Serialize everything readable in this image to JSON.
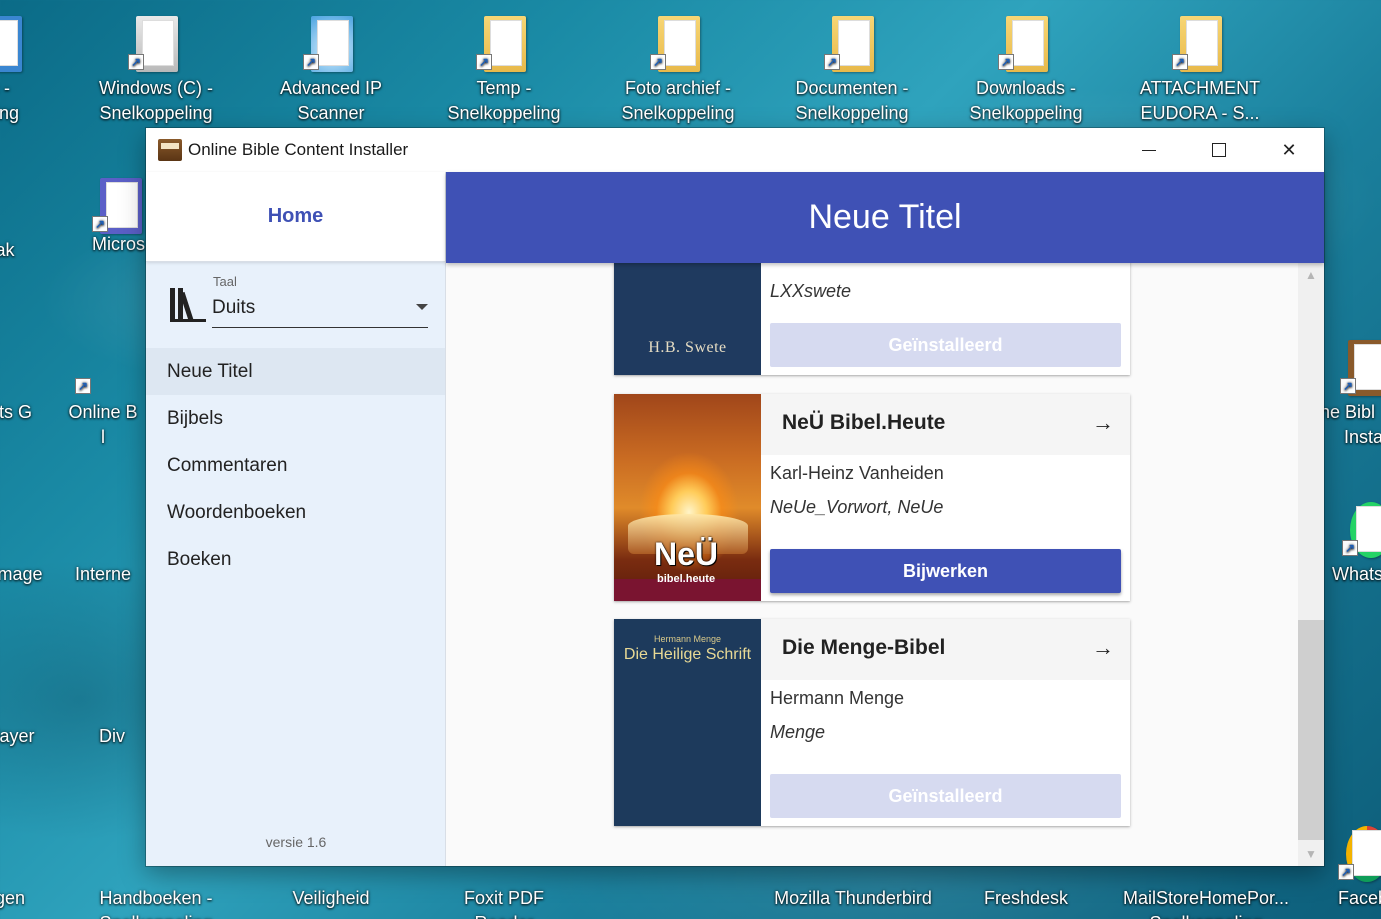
{
  "desktop": {
    "icons": [
      {
        "line1": "c -",
        "line2": "eling"
      },
      {
        "line1": "Windows (C) -",
        "line2": "Snelkoppeling"
      },
      {
        "line1": "Advanced IP Scanner",
        "line2": ""
      },
      {
        "line1": "Temp -",
        "line2": "Snelkoppeling"
      },
      {
        "line1": "Foto archief -",
        "line2": "Snelkoppeling"
      },
      {
        "line1": "Documenten -",
        "line2": "Snelkoppeling"
      },
      {
        "line1": "Downloads -",
        "line2": "Snelkoppeling"
      },
      {
        "line1": "ATTACHMENT",
        "line2": "EUDORA - S..."
      },
      {
        "line1": "oak",
        "line2": ""
      },
      {
        "line1": "Micros",
        "line2": ""
      },
      {
        "line1": "Duits G",
        "line2": ""
      },
      {
        "line1": "Online B",
        "line2": "l"
      },
      {
        "line1": "ne Bibl",
        "line2": "Insta"
      },
      {
        "line1": "e Image",
        "line2": ""
      },
      {
        "line1": "Interne",
        "line2": ""
      },
      {
        "line1": "Whats",
        "line2": ""
      },
      {
        "line1": "player",
        "line2": ""
      },
      {
        "line1": "Div",
        "line2": ""
      },
      {
        "line1": "gen",
        "line2": ""
      },
      {
        "line1": "Handboeken -",
        "line2": "Snelkoppeling"
      },
      {
        "line1": "Veiligheid",
        "line2": ""
      },
      {
        "line1": "Foxit PDF Reader",
        "line2": ""
      },
      {
        "line1": "Mozilla Thunderbird",
        "line2": ""
      },
      {
        "line1": "Freshdesk",
        "line2": ""
      },
      {
        "line1": "MailStoreHomePor...",
        "line2": "Snelkoppeling"
      },
      {
        "line1": "Faceb",
        "line2": ""
      }
    ]
  },
  "window": {
    "title": "Online Bible Content Installer",
    "controls": {
      "minimize": "minimize",
      "maximize": "maximize",
      "close": "✕"
    }
  },
  "sidebar": {
    "home_label": "Home",
    "language": {
      "caption": "Taal",
      "value": "Duits"
    },
    "nav": [
      "Neue Titel",
      "Bijbels",
      "Commentaren",
      "Woordenboeken",
      "Boeken"
    ],
    "active_index": 0,
    "version": "versie 1.6"
  },
  "header": {
    "title": "Neue Titel"
  },
  "cards": [
    {
      "title": "",
      "author": "",
      "module": "LXXswete",
      "button": "Geïnstalleerd",
      "button_state": "disabled",
      "cover_text": "H.B. Swete"
    },
    {
      "title": "NeÜ Bibel.Heute",
      "author": "Karl-Heinz Vanheiden",
      "module": "NeUe_Vorwort, NeUe",
      "button": "Bijwerken",
      "button_state": "active",
      "cover_text": "NeÜ",
      "cover_subtext": "bibel.heute"
    },
    {
      "title": "Die Menge-Bibel",
      "author": "Hermann Menge",
      "module": "Menge",
      "button": "Geïnstalleerd",
      "button_state": "disabled",
      "cover_small": "Hermann Menge",
      "cover_text": "Die Heilige Schrift"
    }
  ],
  "colors": {
    "primary": "#3f51b5",
    "sidebar_bg": "#e8f1fb",
    "disabled_btn": "#d6daf0"
  }
}
